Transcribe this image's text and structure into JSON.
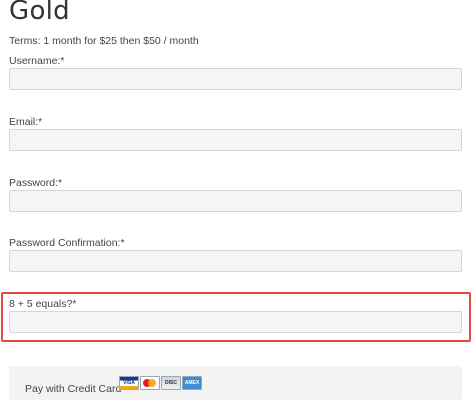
{
  "plan": {
    "title": "Gold",
    "terms": "Terms: 1 month for $25 then $50 / month"
  },
  "form": {
    "username": {
      "label": "Username:*",
      "value": ""
    },
    "email": {
      "label": "Email:*",
      "value": ""
    },
    "password": {
      "label": "Password:*",
      "value": ""
    },
    "password_confirmation": {
      "label": "Password Confirmation:*",
      "value": ""
    },
    "captcha": {
      "label": "8 + 5 equals?*",
      "value": ""
    }
  },
  "payment": {
    "label": "Pay with Credit Card",
    "cards": [
      {
        "name": "visa-icon",
        "text": "VISA"
      },
      {
        "name": "mastercard-icon",
        "text": ""
      },
      {
        "name": "discover-icon",
        "text": "DISC"
      },
      {
        "name": "amex-icon",
        "text": "AMEX"
      }
    ]
  },
  "colors": {
    "highlight_border": "#e04a3f",
    "input_background": "#f5f5f5",
    "input_border": "#d6d6d6"
  }
}
